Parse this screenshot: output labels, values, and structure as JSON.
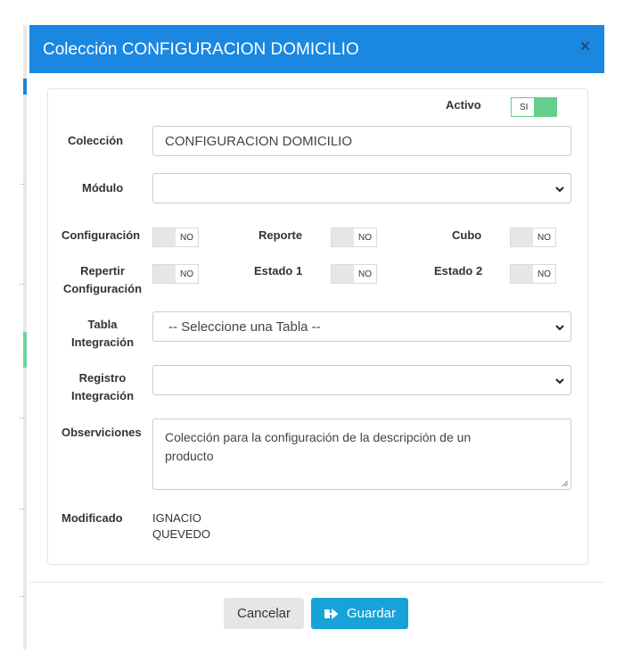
{
  "modal": {
    "title": "Colección CONFIGURACION DOMICILIO",
    "close_glyph": "×"
  },
  "form": {
    "activo_label": "Activo",
    "activo_toggle": "SI",
    "coleccion_label": "Colección",
    "coleccion_value": "CONFIGURACION DOMICILIO",
    "modulo_label": "Módulo",
    "modulo_value": "",
    "configuracion_label": "Configuración",
    "configuracion_toggle": "NO",
    "reporte_label": "Reporte",
    "reporte_toggle": "NO",
    "cubo_label": "Cubo",
    "cubo_toggle": "NO",
    "repertir_label_1": "Repertir",
    "repertir_label_2": "Configuración",
    "repertir_toggle": "NO",
    "estado1_label": "Estado 1",
    "estado1_toggle": "NO",
    "estado2_label": "Estado 2",
    "estado2_toggle": "NO",
    "tabla_label_1": "Tabla",
    "tabla_label_2": "Integración",
    "tabla_value": "-- Seleccione una Tabla --",
    "registro_label_1": "Registro",
    "registro_label_2": "Integración",
    "registro_value": "",
    "observaciones_label": "Observiciones",
    "observaciones_value": "Colección para la configuración de la descripción de un producto",
    "modificado_label": "Modificado",
    "modificado_value_1": "IGNACIO",
    "modificado_value_2": "QUEVEDO"
  },
  "footer": {
    "cancel_label": "Cancelar",
    "save_label": "Guardar"
  },
  "icons": {
    "close": "close-icon",
    "chevron": "chevron-down-icon",
    "save": "save-arrow-icon"
  },
  "colors": {
    "header": "#1a87e0",
    "save_button": "#17a2d8",
    "toggle_on": "#63d08e"
  }
}
